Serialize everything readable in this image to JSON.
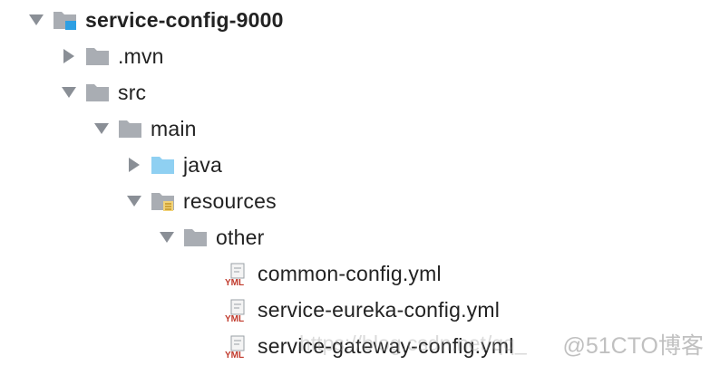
{
  "tree": {
    "root": "service-config-9000",
    "mvn": ".mvn",
    "src": "src",
    "main": "main",
    "java": "java",
    "resources": "resources",
    "other": "other",
    "file1": "common-config.yml",
    "file2": "service-eureka-config.yml",
    "file3": "service-gateway-config.yml",
    "yml_badge": "YML"
  },
  "watermark": {
    "brand": "@51CTO博客",
    "url_fragment": "https://blog.csdn.net/qq_"
  },
  "icons": {
    "folder": "folder-icon",
    "module": "module-folder-icon",
    "source_folder": "source-folder-icon",
    "resources_folder": "resources-folder-icon",
    "yml_file": "yml-file-icon"
  },
  "colors": {
    "folder_gray": "#a9adb3",
    "source_blue": "#8fd0f2",
    "module_blue": "#2d9fe3",
    "yml_red": "#c0392b",
    "arrow": "#8a8f96"
  }
}
